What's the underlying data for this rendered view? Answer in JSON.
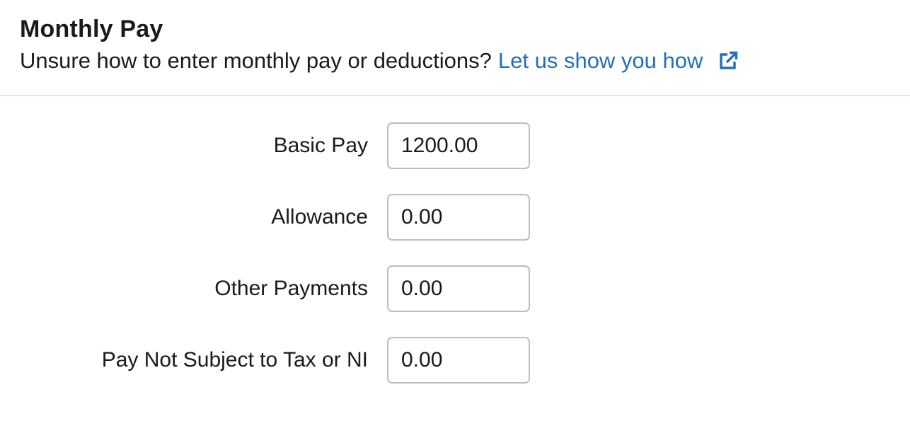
{
  "header": {
    "title": "Monthly Pay",
    "subtitle": "Unsure how to enter monthly pay or deductions?",
    "help_link_label": "Let us show you how",
    "help_link_icon": "external-link-icon",
    "link_color": "#1f6fc0"
  },
  "form": {
    "rows": [
      {
        "label": "Basic Pay",
        "value": "1200.00"
      },
      {
        "label": "Allowance",
        "value": "0.00"
      },
      {
        "label": "Other Payments",
        "value": "0.00"
      },
      {
        "label": "Pay Not Subject to Tax or NI",
        "value": "0.00"
      }
    ]
  }
}
